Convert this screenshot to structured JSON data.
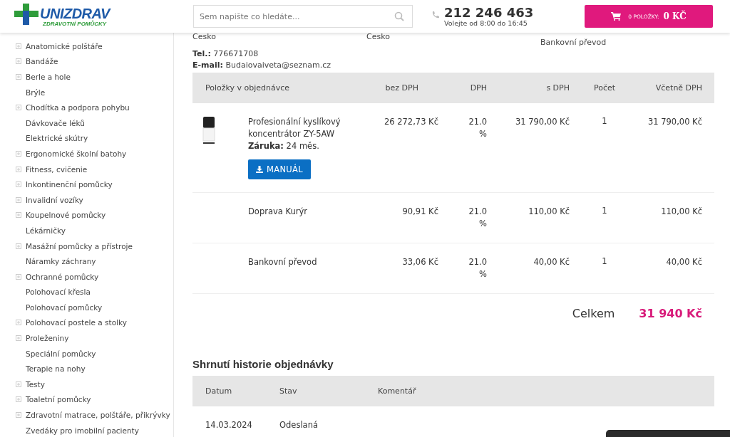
{
  "header": {
    "logo": {
      "name": "UNIZDRAV",
      "tagline": "ZDRAVOTNÍ POMŮCKY"
    },
    "search": {
      "placeholder": "Sem napište co hledáte..."
    },
    "phone": {
      "number": "212 246 463",
      "hours": "Volejte od 8:00 do 16:45"
    },
    "cart": {
      "count": "0 POLOŽKY:",
      "total": "0 KČ"
    }
  },
  "sidebar": {
    "items": [
      {
        "label": "Anatomické polštáře",
        "expandable": true
      },
      {
        "label": "Bandáže",
        "expandable": true
      },
      {
        "label": "Berle a hole",
        "expandable": true
      },
      {
        "label": "Brýle",
        "expandable": false
      },
      {
        "label": "Chodítka a podpora pohybu",
        "expandable": true
      },
      {
        "label": "Dávkovače léků",
        "expandable": false
      },
      {
        "label": "Elektrické skútry",
        "expandable": false
      },
      {
        "label": "Ergonomické školní batohy",
        "expandable": true
      },
      {
        "label": "Fitness, cvičenie",
        "expandable": true
      },
      {
        "label": "Inkontinenční pomůcky",
        "expandable": true
      },
      {
        "label": "Invalidní vozíky",
        "expandable": true
      },
      {
        "label": "Koupelnové pomůcky",
        "expandable": true
      },
      {
        "label": "Lékárničky",
        "expandable": false
      },
      {
        "label": "Masážní pomůcky a přístroje",
        "expandable": true
      },
      {
        "label": "Náramky záchrany",
        "expandable": false
      },
      {
        "label": "Ochranné pomůcky",
        "expandable": true
      },
      {
        "label": "Polohovací křesla",
        "expandable": false
      },
      {
        "label": "Polohovací pomůcky",
        "expandable": false
      },
      {
        "label": "Polohovací postele a stolky",
        "expandable": true
      },
      {
        "label": "Proleženiny",
        "expandable": true
      },
      {
        "label": "Speciální pomůcky",
        "expandable": false
      },
      {
        "label": "Terapie na nohy",
        "expandable": false
      },
      {
        "label": "Testy",
        "expandable": true
      },
      {
        "label": "Toaletní pomůcky",
        "expandable": true
      },
      {
        "label": "Zdravotní matrace, polštáře, přikrývky",
        "expandable": true
      },
      {
        "label": "Zvedáky pro imobilní pacienty",
        "expandable": false
      }
    ]
  },
  "address": {
    "columns": [
      "Cesko",
      "Cesko",
      "Bankovní převod"
    ],
    "phone": {
      "label": "Tel.:",
      "value": "776671708"
    },
    "email": {
      "label": "E-mail:",
      "value": "Budaiovaiveta@seznam.cz"
    }
  },
  "order_table": {
    "columns": [
      "Položky v objednávce",
      "bez DPH",
      "DPH",
      "s DPH",
      "Počet",
      "Včetně DPH"
    ],
    "rows": [
      {
        "kind": "product",
        "name": "Profesionální kyslíkový koncentrátor ZY-5AW",
        "warranty": "**Záruka:** 24 měs.",
        "button": "MANUÁL",
        "net": "26 272,73 Kč",
        "vat": "21.0 %",
        "gross": "31 790,00 Kč",
        "qty": "1",
        "total": "31 790,00 Kč"
      },
      {
        "kind": "service",
        "name": "Doprava Kurýr",
        "net": "90,91 Kč",
        "vat": "21.0 %",
        "gross": "110,00 Kč",
        "qty": "1",
        "total": "110,00 Kč"
      },
      {
        "kind": "service",
        "name": "Bankovní převod",
        "net": "33,06 Kč",
        "vat": "21.0 %",
        "gross": "40,00 Kč",
        "qty": "1",
        "total": "40,00 Kč"
      }
    ],
    "total": {
      "label": "Celkem",
      "value": "31 940 Kč"
    }
  },
  "history": {
    "title": "Shrnutí historie objednávky",
    "columns": [
      "Datum",
      "Stav",
      "Komentář"
    ],
    "rows": [
      {
        "date": "14.03.2024",
        "status": "Odeslaná"
      }
    ]
  }
}
